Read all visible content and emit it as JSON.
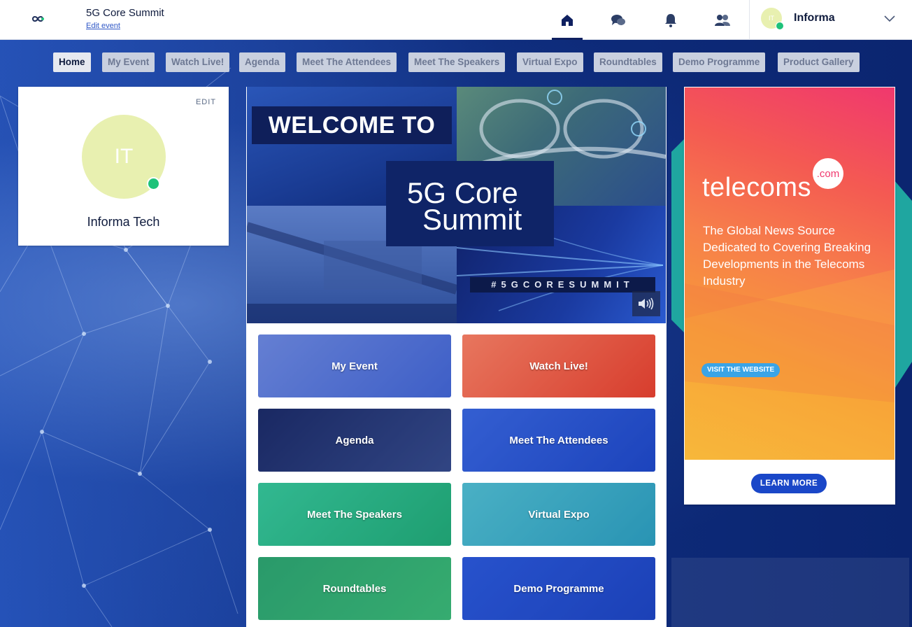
{
  "header": {
    "logo_icon": "infinity-logo-icon",
    "event_title": "5G Core Summit",
    "edit_event": "Edit event",
    "nav_icons": [
      "home-icon",
      "chat-icon",
      "bell-icon",
      "people-icon"
    ],
    "user": {
      "initials": "IT",
      "name": "Informa",
      "status_color": "#1ec27a"
    }
  },
  "tabs": [
    {
      "label": "Home",
      "active": true
    },
    {
      "label": "My Event"
    },
    {
      "label": "Watch Live!"
    },
    {
      "label": "Agenda"
    },
    {
      "label": "Meet The Attendees"
    },
    {
      "label": "Meet The Speakers"
    },
    {
      "label": "Virtual Expo"
    },
    {
      "label": "Roundtables"
    },
    {
      "label": "Demo Programme"
    },
    {
      "label": "Product Gallery"
    }
  ],
  "profile": {
    "edit_label": "EDIT",
    "initials": "IT",
    "name": "Informa Tech"
  },
  "hero": {
    "welcome": "WELCOME TO",
    "title_line1": "5G Core",
    "title_line2": "Summit",
    "hashtag": "#5GCORESUMMIT"
  },
  "tiles": [
    {
      "label": "My Event"
    },
    {
      "label": "Watch Live!"
    },
    {
      "label": "Agenda"
    },
    {
      "label": "Meet The Attendees"
    },
    {
      "label": "Meet The Speakers"
    },
    {
      "label": "Virtual Expo"
    },
    {
      "label": "Roundtables"
    },
    {
      "label": "Demo Programme"
    }
  ],
  "ad": {
    "brand": "telecoms",
    "brand_com": ".com",
    "tagline": "The Global News Source Dedicated to Covering Breaking Developments in the Telecoms Industry",
    "visit": "VISIT THE WEBSITE",
    "learn_more": "LEARN MORE"
  },
  "colors": {
    "accent": "#1a47c8",
    "navy": "#0f1b3d",
    "online": "#1ec27a"
  }
}
